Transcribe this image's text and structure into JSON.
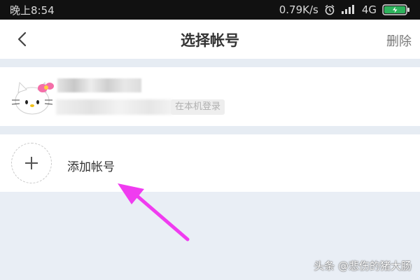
{
  "status_bar": {
    "time": "晚上8:54",
    "network_speed": "0.79K/s",
    "network_type": "4G",
    "icons": [
      "alarm-icon",
      "signal-icon",
      "battery-icon"
    ]
  },
  "nav": {
    "title": "选择帐号",
    "delete_label": "删除",
    "back_icon": "chevron-left-icon"
  },
  "account": {
    "avatar": "hello-kitty-avatar",
    "login_badge": "在本机登录"
  },
  "add_account": {
    "label": "添加帐号",
    "icon": "plus-icon"
  },
  "annotation": {
    "arrow_color": "#f03cf0"
  },
  "watermark": "头条 @悲伤的猪大肠"
}
